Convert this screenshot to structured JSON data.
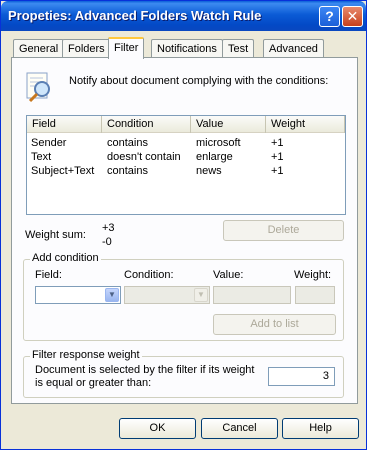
{
  "window": {
    "title": "Propeties: Advanced Folders Watch Rule",
    "help_glyph": "?",
    "close_glyph": "✕"
  },
  "tabs": [
    {
      "label": "General",
      "active": false
    },
    {
      "label": "Folders",
      "active": false
    },
    {
      "label": "Filter",
      "active": true
    },
    {
      "label": "Notifications",
      "active": false
    },
    {
      "label": "Test",
      "active": false
    },
    {
      "label": "Advanced",
      "active": false
    }
  ],
  "intro": {
    "icon": "magnifier-document-icon",
    "text": "Notify about document complying with the conditions:"
  },
  "conditions": {
    "columns": [
      "Field",
      "Condition",
      "Value",
      "Weight"
    ],
    "rows": [
      {
        "field": "Sender",
        "condition": "contains",
        "value": "microsoft",
        "weight": "+1"
      },
      {
        "field": "Text",
        "condition": "doesn't contain",
        "value": "enlarge",
        "weight": "+1"
      },
      {
        "field": "Subject+Text",
        "condition": "contains",
        "value": "news",
        "weight": "+1"
      }
    ]
  },
  "weight_sum": {
    "label": "Weight sum:",
    "positive": "+3",
    "negative": "-0"
  },
  "delete_label": "Delete",
  "add_condition": {
    "title": "Add condition",
    "field_label": "Field:",
    "condition_label": "Condition:",
    "value_label": "Value:",
    "weight_label": "Weight:",
    "field_value": "",
    "condition_value": "",
    "value_value": "",
    "weight_value": "",
    "add_label": "Add to list"
  },
  "filter_response": {
    "title": "Filter response weight",
    "description": "Document is selected by the filter if its weight is equal or greater than:",
    "threshold": "3"
  },
  "footer": {
    "ok": "OK",
    "cancel": "Cancel",
    "help": "Help"
  },
  "colors": {
    "titlebar": "#0b5bd6",
    "dialog_bg": "#ece9d8",
    "active_tab_accent": "#ffc83c"
  }
}
